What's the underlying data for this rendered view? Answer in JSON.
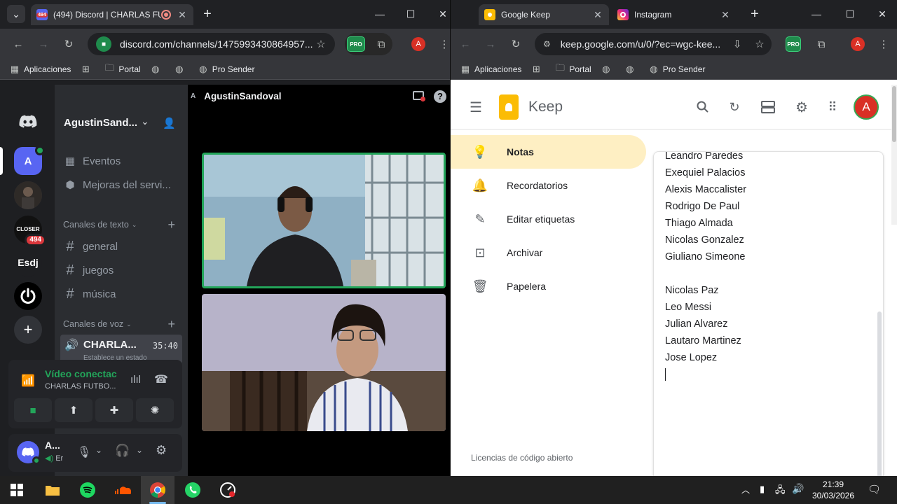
{
  "left_browser": {
    "tab_discord_badge": "494",
    "tab_discord_title": "(494) Discord | CHARLAS FU",
    "url": "discord.com/channels/1475993430864957...",
    "profile_letter": "A",
    "pro_label": "PRO",
    "bookmarks": [
      "Aplicaciones",
      "Portal",
      "Pro Sender"
    ]
  },
  "right_browser": {
    "tabs": [
      {
        "title": "Google Keep"
      },
      {
        "title": "Instagram"
      }
    ],
    "url": "keep.google.com/u/0/?ec=wgc-kee...",
    "profile_letter": "A",
    "pro_label": "PRO",
    "bookmarks": [
      "Aplicaciones",
      "Portal",
      "Pro Sender"
    ]
  },
  "discord": {
    "topbar_user_initial": "A",
    "topbar_user": "AgustinSandoval",
    "guild_letter": "A",
    "guild_closer_text": "CLOSER",
    "guild_closer_badge": "494",
    "guild_text_esdj": "Esdj",
    "server_name": "AgustinSand...",
    "channels_top": [
      "Eventos",
      "Mejoras del servi..."
    ],
    "text_category": "Canales de texto",
    "text_channels": [
      "general",
      "juegos",
      "música"
    ],
    "voice_category": "Canales de voz",
    "voice_channel": "CHARLA...",
    "voice_time": "35:40",
    "voice_status": "Establece un estado",
    "connection_status": "Vídeo conectac",
    "connection_channel": "CHARLAS FUTBO...",
    "user_name": "A...",
    "user_status": "Er",
    "colors": {
      "green": "#23a55a",
      "blurple": "#5865f2",
      "red": "#da373c"
    }
  },
  "keep": {
    "app_name": "Keep",
    "avatar_letter": "A",
    "nav": [
      {
        "label": "Notas",
        "icon": "lightbulb-icon"
      },
      {
        "label": "Recordatorios",
        "icon": "bell-icon"
      },
      {
        "label": "Editar etiquetas",
        "icon": "pencil-icon"
      },
      {
        "label": "Archivar",
        "icon": "archive-icon"
      },
      {
        "label": "Papelera",
        "icon": "trash-icon"
      }
    ],
    "footer": "Licencias de código abierto",
    "note_lines": [
      "Leandro Paredes",
      "Exequiel Palacios",
      "Alexis Maccalister",
      "Rodrigo De Paul",
      "Thiago Almada",
      "Nicolas Gonzalez",
      "Giuliano Simeone",
      "",
      "Nicolas Paz",
      "Leo Messi",
      "Julian Alvarez",
      "Lautaro Martinez",
      "Jose Lopez"
    ]
  },
  "taskbar": {
    "time": "21:39",
    "date": "30/03/2026"
  }
}
